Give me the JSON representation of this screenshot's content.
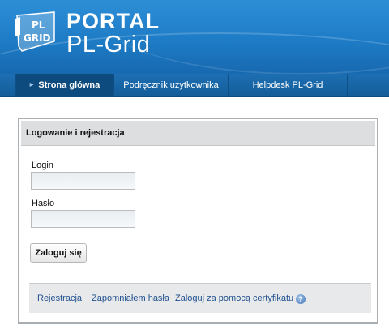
{
  "brand": {
    "title": "PORTAL",
    "subtitle": "PL-Grid",
    "logo_mark_text": [
      "PL",
      "GRID"
    ]
  },
  "nav": {
    "items": [
      {
        "label": "Strona główna",
        "active": true
      },
      {
        "label": "Podręcznik użytkownika",
        "active": false
      },
      {
        "label": "Helpdesk PL-Grid",
        "active": false
      }
    ]
  },
  "login_panel": {
    "title": "Logowanie i rejestracja",
    "login_label": "Login",
    "login_value": "",
    "password_label": "Hasło",
    "password_value": "",
    "submit_label": "Zaloguj się"
  },
  "footer_links": {
    "register": "Rejestracja",
    "forgot_password": "Zapomniałem hasła",
    "certificate_login": "Zaloguj za pomocą certyfikatu",
    "help_icon": "help-icon"
  },
  "colors": {
    "header_blue": "#1e7cc6",
    "nav_blue": "#135c98",
    "nav_active": "#0d4a7e",
    "link": "#1f4f8f"
  }
}
